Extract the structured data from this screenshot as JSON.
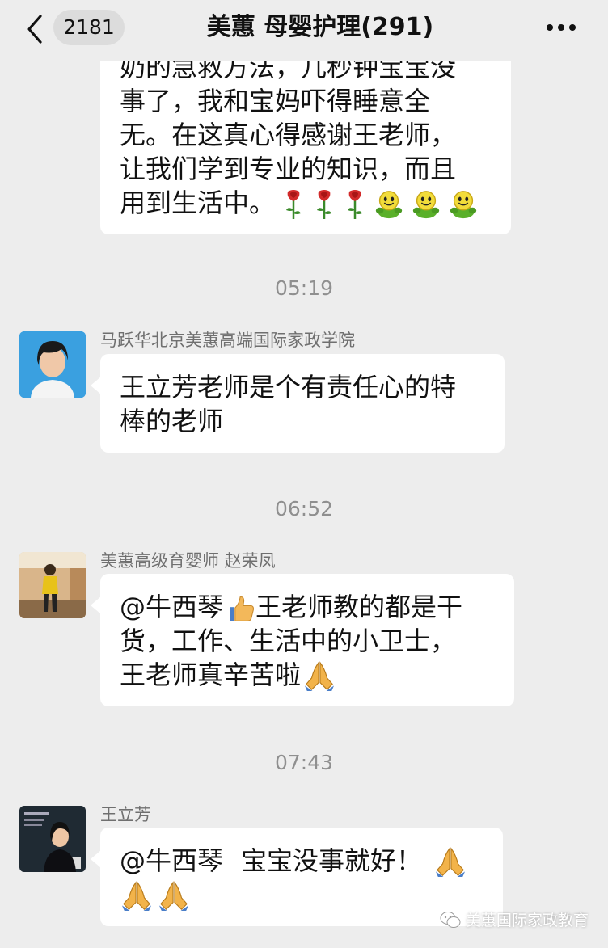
{
  "header": {
    "unread_count": "2181",
    "title": "美蕙 母婴护理(291)"
  },
  "messages": [
    {
      "lines": [
        "奶的急救方法，几秒钟宝宝没",
        "事了，我和宝妈吓得睡意全",
        "无。在这真心得感谢王老师，",
        "让我们学到专业的知识，而且",
        "用到生活中。"
      ],
      "emojis": [
        "rose-emoji",
        "rose-emoji",
        "rose-emoji",
        "smile-emoji",
        "smile-emoji",
        "smile-emoji"
      ]
    },
    {
      "time": "05:19",
      "sender": "马跃华北京美蕙高端国际家政学院",
      "lines": [
        "王立芳老师是个有责任心的特",
        "棒的老师"
      ]
    },
    {
      "time": "06:52",
      "sender": "美蕙高级育婴师 赵荣凤",
      "mention": "@牛西琴",
      "line1_after": "王老师教的都是干",
      "lines": [
        "货，工作、生活中的小卫士，",
        "王老师真辛苦啦"
      ],
      "emojis": [
        "thumbs-up-emoji",
        "pray-emoji"
      ]
    },
    {
      "time": "07:43",
      "sender": "王立芳",
      "mention": "@牛西琴",
      "text": "宝宝没事就好！",
      "emojis": [
        "pray-emoji",
        "pray-emoji",
        "pray-emoji"
      ]
    }
  ],
  "watermark": "美蕙国际家政教育",
  "colors": {
    "background": "#ededed",
    "bubble": "#ffffff",
    "avatar1_bg": "#3aa0e0"
  }
}
